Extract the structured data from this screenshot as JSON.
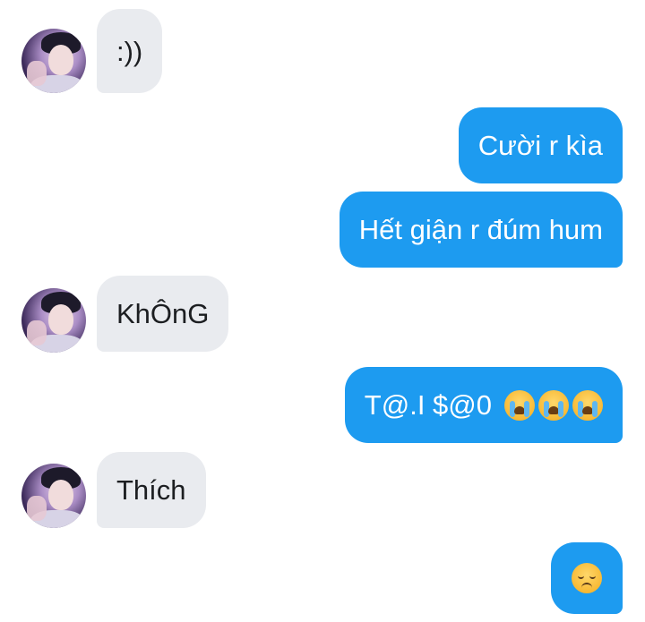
{
  "colors": {
    "outgoing_bubble": "#1d9bf0",
    "incoming_bubble": "#e9ebef",
    "outgoing_text": "#ffffff",
    "incoming_text": "#1c1e21",
    "background": "#ffffff"
  },
  "messages": [
    {
      "direction": "incoming",
      "text": ":))"
    },
    {
      "direction": "outgoing",
      "text": "Cười r kìa"
    },
    {
      "direction": "outgoing",
      "text": "Hết giận r đúm hum"
    },
    {
      "direction": "incoming",
      "text": "KhÔnG"
    },
    {
      "direction": "outgoing",
      "text": "T@.I $@0",
      "emoji": [
        "loudly-crying-face-icon",
        "loudly-crying-face-icon",
        "loudly-crying-face-icon"
      ]
    },
    {
      "direction": "incoming",
      "text": "Thích"
    },
    {
      "direction": "outgoing",
      "text": "",
      "emoji": [
        "disappointed-face-icon"
      ]
    }
  ]
}
